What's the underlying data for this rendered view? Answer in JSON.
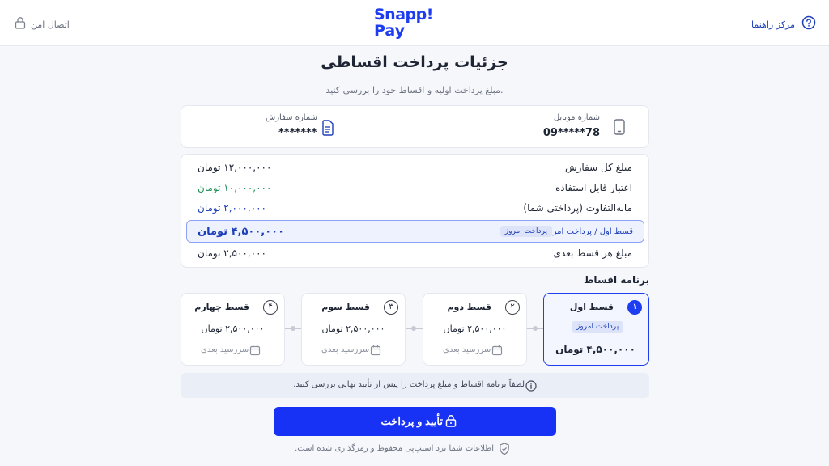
{
  "header": {
    "help_label": "مرکز راهنما",
    "secure_label": "اتصال امن",
    "logo_line1": "Snapp!",
    "logo_line2": "Pay"
  },
  "page": {
    "title": "جزئیات پرداخت اقساطی",
    "subtitle": "مبلغ پرداخت اولیه و اقساط خود را بررسی کنید."
  },
  "info": {
    "phone_label": "شماره موبایل",
    "phone_value": "09*****78",
    "order_label": "شماره سفارش",
    "order_value": "*******"
  },
  "summary": {
    "rows": [
      {
        "label": "مبلغ کل سفارش",
        "value": "۱۲,۰۰۰,۰۰۰ تومان"
      },
      {
        "label": "اعتبار قابل استفاده",
        "value": "۱۰,۰۰۰,۰۰۰ تومان"
      },
      {
        "label": "مابه‌التفاوت (پرداختی شما)",
        "value": "۲,۰۰۰,۰۰۰ تومان"
      },
      {
        "label": "قسط اول / پرداخت امروز",
        "value": "۴,۵۰۰,۰۰۰ تومان",
        "badge": "پرداخت امروز"
      },
      {
        "label": "مبلغ هر قسط بعدی",
        "value": "۲,۵۰۰,۰۰۰ تومان"
      }
    ]
  },
  "plan": {
    "title": "برنامه اقساط",
    "installments": [
      {
        "num": "۱",
        "name": "قسط اول",
        "amount": "۴,۵۰۰,۰۰۰ تومان",
        "badge": "پرداخت امروز"
      },
      {
        "num": "۲",
        "name": "قسط دوم",
        "amount": "۲,۵۰۰,۰۰۰ تومان",
        "due": "سررسید بعدی"
      },
      {
        "num": "۳",
        "name": "قسط سوم",
        "amount": "۲,۵۰۰,۰۰۰ تومان",
        "due": "سررسید بعدی"
      },
      {
        "num": "۴",
        "name": "قسط چهارم",
        "amount": "۲,۵۰۰,۰۰۰ تومان",
        "due": "سررسید بعدی"
      }
    ]
  },
  "notice": "لطفاً برنامه اقساط و مبلغ پرداخت را پیش از تأیید نهایی بررسی کنید.",
  "cta": {
    "label": "تأیید و پرداخت"
  },
  "footer": "اطلاعات شما نزد اسنپ‌پی محفوظ و رمزگذاری شده است.",
  "colors": {
    "brand": "#1e3cf0",
    "cta": "#1732f5",
    "positive": "#23935a",
    "link": "#1d3fb8"
  }
}
